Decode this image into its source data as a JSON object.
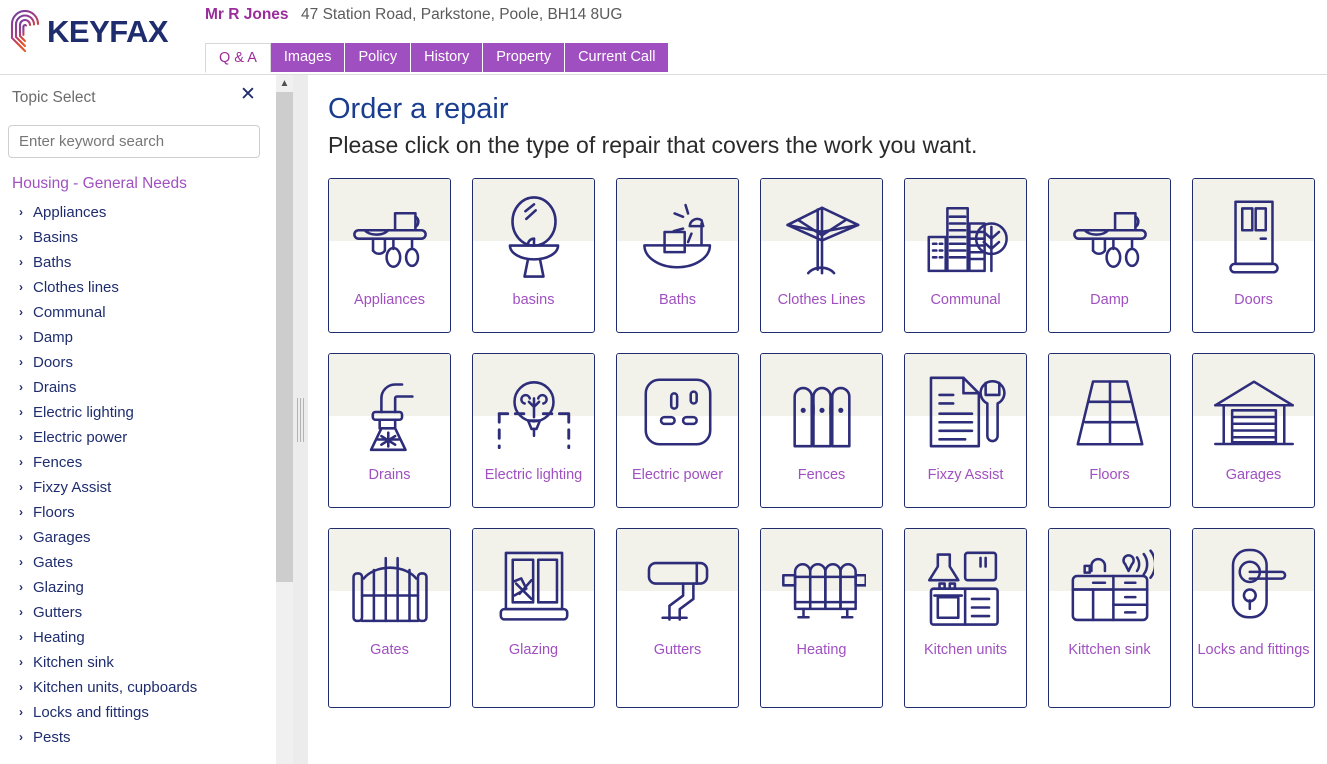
{
  "app": {
    "logo_text": "KEYFAX",
    "logo_icon": "fingerprint-icon"
  },
  "header": {
    "user_name": "Mr R Jones",
    "user_address": "47 Station Road, Parkstone, Poole, BH14 8UG",
    "tabs": [
      {
        "label": "Q & A",
        "active": true
      },
      {
        "label": "Images",
        "active": false
      },
      {
        "label": "Policy",
        "active": false
      },
      {
        "label": "History",
        "active": false
      },
      {
        "label": "Property",
        "active": false
      },
      {
        "label": "Current Call",
        "active": false
      }
    ]
  },
  "sidebar": {
    "title": "Topic Select",
    "close_icon": "close-icon",
    "search": {
      "value": "",
      "placeholder": "Enter keyword search"
    },
    "group_heading": "Housing - General Needs",
    "items": [
      {
        "label": "Appliances"
      },
      {
        "label": "Basins"
      },
      {
        "label": "Baths"
      },
      {
        "label": "Clothes lines"
      },
      {
        "label": "Communal"
      },
      {
        "label": "Damp"
      },
      {
        "label": "Doors"
      },
      {
        "label": "Drains"
      },
      {
        "label": "Electric lighting"
      },
      {
        "label": "Electric power"
      },
      {
        "label": "Fences"
      },
      {
        "label": "Fixzy Assist"
      },
      {
        "label": "Floors"
      },
      {
        "label": "Garages"
      },
      {
        "label": "Gates"
      },
      {
        "label": "Glazing"
      },
      {
        "label": "Gutters"
      },
      {
        "label": "Heating"
      },
      {
        "label": "Kitchen sink"
      },
      {
        "label": "Kitchen units, cupboards"
      },
      {
        "label": "Locks and fittings"
      },
      {
        "label": "Pests"
      }
    ],
    "chevron_icon": "chevron-right-icon",
    "scroll_up_icon": "chevron-up-icon"
  },
  "main": {
    "title": "Order a repair",
    "subtitle": "Please click on the type of repair that covers the work you want.",
    "cards": [
      {
        "label": "Appliances",
        "icon": "shelf-dishes-icon"
      },
      {
        "label": "basins",
        "icon": "basin-icon"
      },
      {
        "label": "Baths",
        "icon": "bath-shower-icon"
      },
      {
        "label": "Clothes Lines",
        "icon": "rotary-clothes-line-icon"
      },
      {
        "label": "Communal",
        "icon": "buildings-tree-icon"
      },
      {
        "label": "Damp",
        "icon": "shelf-dishes-icon"
      },
      {
        "label": "Doors",
        "icon": "door-icon"
      },
      {
        "label": "Drains",
        "icon": "drain-pipe-icon"
      },
      {
        "label": "Electric lighting",
        "icon": "light-bulb-icon"
      },
      {
        "label": "Electric power",
        "icon": "power-socket-icon"
      },
      {
        "label": "Fences",
        "icon": "fence-icon"
      },
      {
        "label": "Fixzy Assist",
        "icon": "document-wrench-icon"
      },
      {
        "label": "Floors",
        "icon": "floor-tiles-icon"
      },
      {
        "label": "Garages",
        "icon": "garage-icon"
      },
      {
        "label": "Gates",
        "icon": "gate-icon"
      },
      {
        "label": "Glazing",
        "icon": "broken-window-icon"
      },
      {
        "label": "Gutters",
        "icon": "gutter-downpipe-icon"
      },
      {
        "label": "Heating",
        "icon": "radiator-icon"
      },
      {
        "label": "Kitchen units",
        "icon": "kitchen-units-icon"
      },
      {
        "label": "Kittchen sink",
        "icon": "kitchen-sink-icon"
      },
      {
        "label": "Locks and fittings",
        "icon": "door-handle-lock-icon"
      }
    ]
  },
  "colors": {
    "brand_navy": "#1f2d6e",
    "tab_purple": "#a04fc0",
    "label_purple": "#a050c0",
    "heading_blue": "#1a3d8f",
    "card_band": "#f2f1ea"
  }
}
